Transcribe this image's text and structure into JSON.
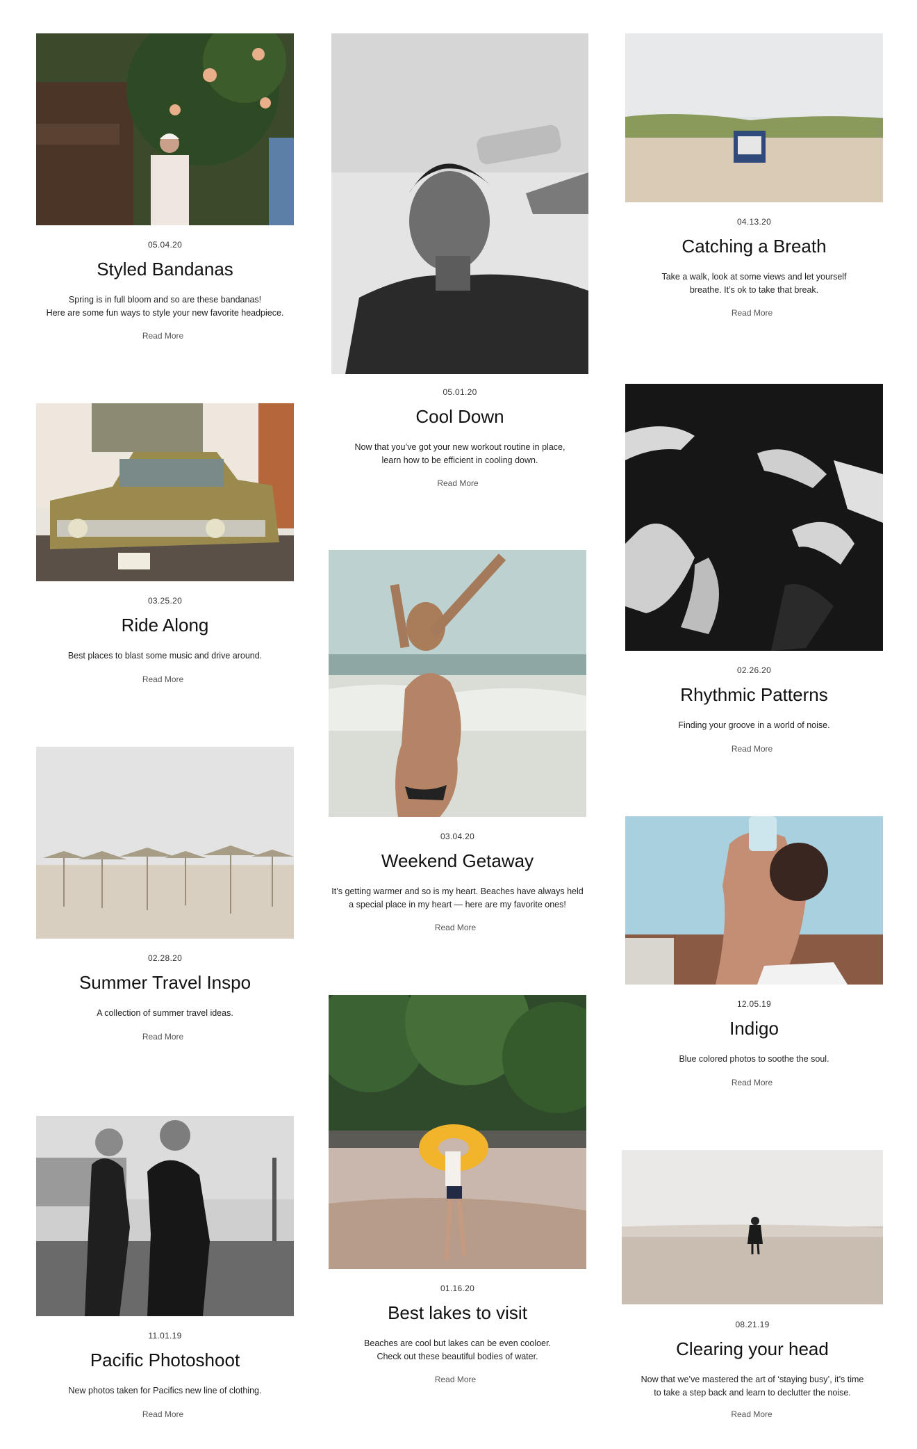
{
  "posts": [
    {
      "date": "05.04.20",
      "title": "Styled Bandanas",
      "excerpt": "Spring is in full bloom and so are these bandanas!\nHere are some fun ways to style your new favorite headpiece.",
      "more": "Read More"
    },
    {
      "date": "05.01.20",
      "title": "Cool Down",
      "excerpt": "Now that you’ve got your new workout routine in place,\nlearn how to be efficient in cooling down.",
      "more": "Read More"
    },
    {
      "date": "04.13.20",
      "title": "Catching a Breath",
      "excerpt": "Take a walk, look at some views and let yourself\nbreathe. It’s ok to take that break.",
      "more": "Read More"
    },
    {
      "date": "03.25.20",
      "title": "Ride Along",
      "excerpt": "Best places to blast some music and drive around.",
      "more": "Read More"
    },
    {
      "date": "03.04.20",
      "title": "Weekend Getaway",
      "excerpt": "It’s getting warmer and so is my heart. Beaches have always held\na special place in my heart — here are my favorite ones!",
      "more": "Read More"
    },
    {
      "date": "02.26.20",
      "title": "Rhythmic Patterns",
      "excerpt": "Finding your groove in a world of noise.",
      "more": "Read More"
    },
    {
      "date": "02.28.20",
      "title": "Summer Travel Inspo",
      "excerpt": "A collection of summer travel ideas.",
      "more": "Read More"
    },
    {
      "date": "12.05.19",
      "title": "Indigo",
      "excerpt": "Blue colored photos to soothe the soul.",
      "more": "Read More"
    },
    {
      "date": "01.16.20",
      "title": "Best lakes to visit",
      "excerpt": "Beaches are cool but lakes can be even cooloer.\nCheck out these beautiful bodies of water.",
      "more": "Read More"
    },
    {
      "date": "11.01.19",
      "title": "Pacific Photoshoot",
      "excerpt": "New photos taken for Pacifics new line of clothing.",
      "more": "Read More"
    },
    {
      "date": "08.21.19",
      "title": "Clearing your head",
      "excerpt": "Now that we’ve mastered the art of ‘staying busy’, it’s time\nto take a step back and learn to declutter the noise.",
      "more": "Read More"
    }
  ]
}
